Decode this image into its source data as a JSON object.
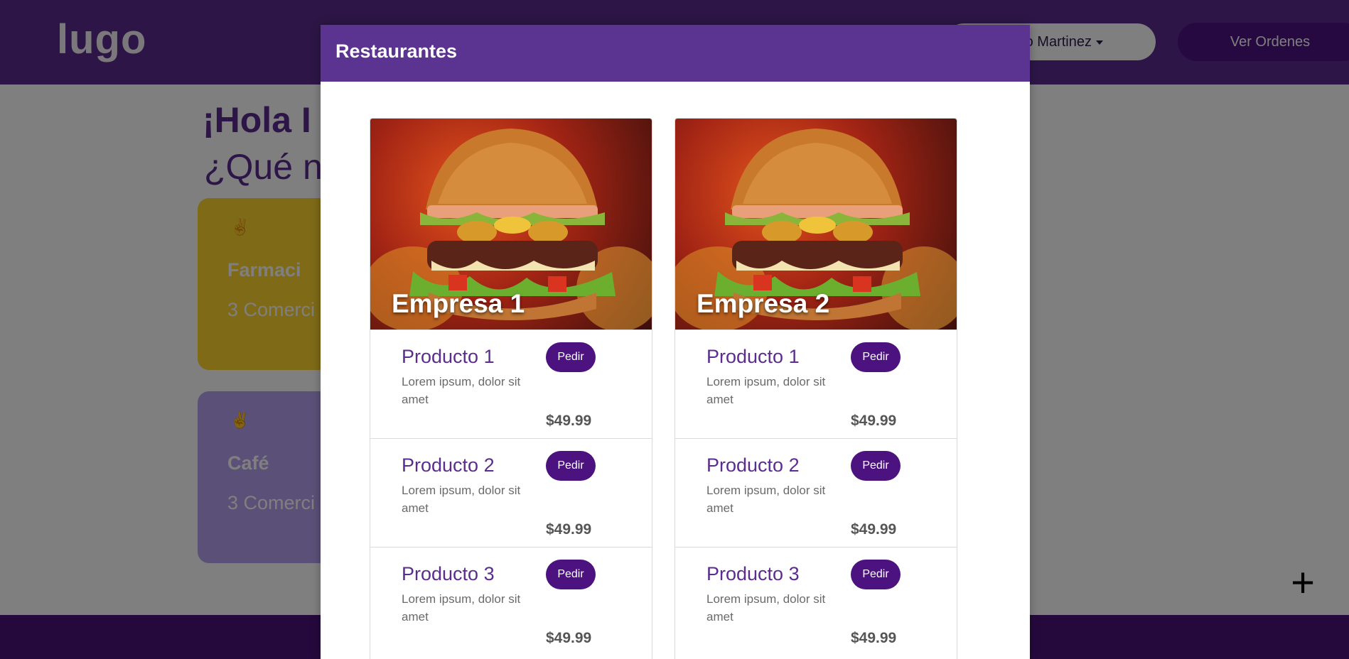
{
  "navbar": {
    "logo": "lugo",
    "user_name": "o Martinez",
    "orders_label": "Ver Ordenes"
  },
  "page": {
    "greeting": "¡Hola I",
    "question": "¿Qué ne"
  },
  "categories": [
    {
      "icon": "✌",
      "name": "Farmaci",
      "count": "3 Comerci",
      "color": "#fcd52f"
    },
    {
      "icon": "✌",
      "name": "Café",
      "count": "3 Comerci",
      "color": "#b7a1f0"
    }
  ],
  "fab": {
    "icon": "plus-icon",
    "symbol": "+"
  },
  "modal": {
    "title": "Restaurantes",
    "restaurants": [
      {
        "name": "Empresa 1",
        "image": "burger-image",
        "products": [
          {
            "name": "Producto 1",
            "desc": "Lorem ipsum, dolor sit amet",
            "button": "Pedir",
            "price": "$49.99"
          },
          {
            "name": "Producto 2",
            "desc": "Lorem ipsum, dolor sit amet",
            "button": "Pedir",
            "price": "$49.99"
          },
          {
            "name": "Producto 3",
            "desc": "Lorem ipsum, dolor sit amet",
            "button": "Pedir",
            "price": "$49.99"
          }
        ]
      },
      {
        "name": "Empresa 2",
        "image": "burger-image",
        "products": [
          {
            "name": "Producto 1",
            "desc": "Lorem ipsum, dolor sit amet",
            "button": "Pedir",
            "price": "$49.99"
          },
          {
            "name": "Producto 2",
            "desc": "Lorem ipsum, dolor sit amet",
            "button": "Pedir",
            "price": "$49.99"
          },
          {
            "name": "Producto 3",
            "desc": "Lorem ipsum, dolor sit amet",
            "button": "Pedir",
            "price": "$49.99"
          }
        ]
      }
    ]
  },
  "colors": {
    "brand_purple": "#5b2d8e",
    "button_purple": "#4b1280",
    "footer_purple": "#4a1379",
    "yellow_card": "#fcd52f",
    "lavender_card": "#b7a1f0"
  }
}
